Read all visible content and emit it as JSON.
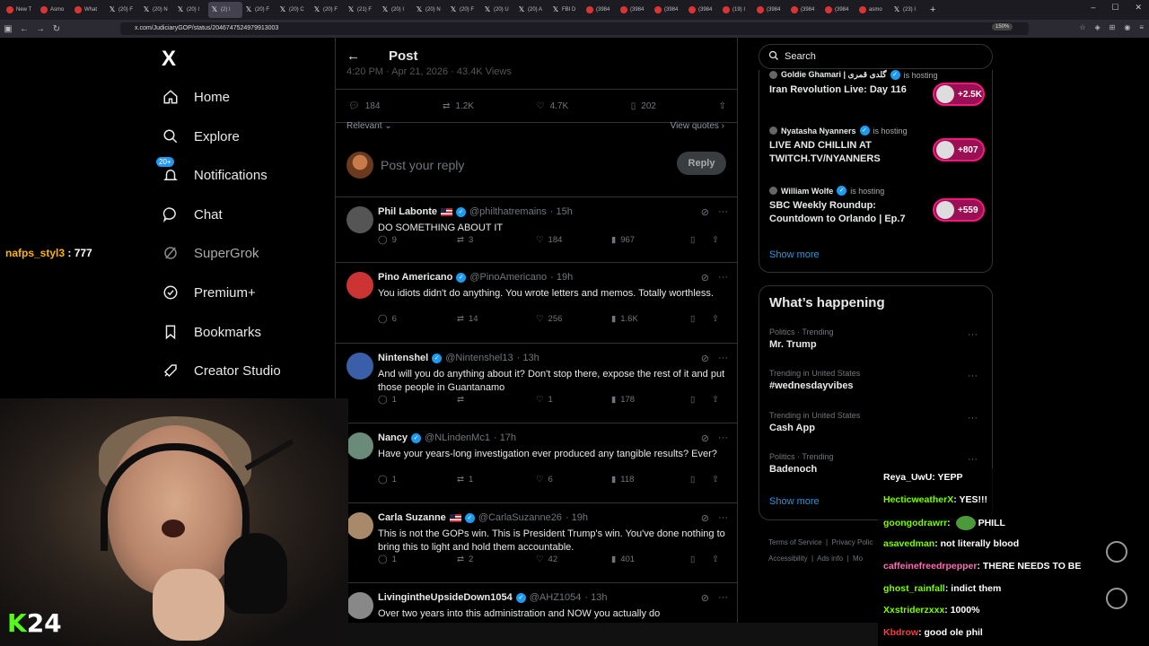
{
  "browser": {
    "tabs": [
      {
        "label": "New T",
        "fav": "red"
      },
      {
        "label": "Asmo",
        "fav": "red"
      },
      {
        "label": "What",
        "fav": "red"
      },
      {
        "label": "(20) F",
        "fav": "x"
      },
      {
        "label": "(20) N",
        "fav": "x"
      },
      {
        "label": "(20) I",
        "fav": "x"
      },
      {
        "label": "(20) F",
        "fav": "x"
      },
      {
        "label": "(20) C",
        "fav": "x"
      },
      {
        "label": "(20) F",
        "fav": "x"
      },
      {
        "label": "(21) F",
        "fav": "x"
      },
      {
        "label": "(20) I",
        "fav": "x"
      },
      {
        "label": "(20) N",
        "fav": "x"
      },
      {
        "label": "(20) F",
        "fav": "x"
      },
      {
        "label": "(20) U",
        "fav": "x"
      },
      {
        "label": "(20) A",
        "fav": "x"
      },
      {
        "label": "FBI D",
        "fav": "x"
      },
      {
        "label": "(3984",
        "fav": "red"
      },
      {
        "label": "(3984",
        "fav": "red"
      },
      {
        "label": "(3984",
        "fav": "red"
      },
      {
        "label": "(3984",
        "fav": "red"
      },
      {
        "label": "(19) I",
        "fav": "red"
      },
      {
        "label": "(3984",
        "fav": "red"
      },
      {
        "label": "(3984",
        "fav": "red"
      },
      {
        "label": "(3984",
        "fav": "red"
      },
      {
        "label": "asmo",
        "fav": "red"
      },
      {
        "label": "(23) I",
        "fav": "x"
      }
    ],
    "active_tab_label": "(2) I",
    "url": "x.com/JudiciaryGOP/status/2046747524979913003",
    "zoom": "150%"
  },
  "nav": {
    "logo": "X",
    "home": "Home",
    "explore": "Explore",
    "notifications": "Notifications",
    "notifications_badge": "20+",
    "chat": "Chat",
    "supergrok": "SuperGrok",
    "premium": "Premium+",
    "bookmarks": "Bookmarks",
    "creator_studio": "Creator Studio"
  },
  "post": {
    "header_title": "Post",
    "date_line": "4:20 PM · Apr 21, 2026 · 43.4K Views",
    "replies": "184",
    "reposts": "1.2K",
    "likes": "4.7K",
    "bookmarks": "202",
    "sort": "Relevant",
    "view_quotes": "View quotes",
    "reply_placeholder": "Post your reply",
    "reply_button": "Reply"
  },
  "replies": [
    {
      "name": "Phil Labonte",
      "flag": true,
      "handle": "@philthatremains",
      "time": "· 15h",
      "text": "DO SOMETHING ABOUT IT",
      "replies": "9",
      "reposts": "3",
      "likes": "184",
      "views": "967",
      "avatar": "#555"
    },
    {
      "name": "Pino Americano",
      "flag": false,
      "handle": "@PinoAmericano",
      "time": "· 19h",
      "text": "You idiots didn't do anything. You wrote letters and memos. Totally worthless.",
      "replies": "6",
      "reposts": "14",
      "likes": "256",
      "views": "1.6K",
      "avatar": "#c33"
    },
    {
      "name": "Nintenshel",
      "flag": false,
      "handle": "@Nintenshel13",
      "time": "· 13h",
      "text": "And will you do anything about it? Don't stop there, expose the rest of it and put those people in Guantanamo",
      "replies": "1",
      "reposts": "",
      "likes": "1",
      "views": "178",
      "avatar": "#3a5fa8"
    },
    {
      "name": "Nancy",
      "flag": false,
      "handle": "@NLindenMc1",
      "time": "· 17h",
      "text": "Have your years-long investigation ever produced any tangible results? Ever?",
      "replies": "1",
      "reposts": "1",
      "likes": "6",
      "views": "118",
      "avatar": "#6a8a7a"
    },
    {
      "name": "Carla Suzanne",
      "flag": true,
      "handle": "@CarlaSuzanne26",
      "time": "· 19h",
      "text": "This is not the GOPs win. This is President Trump's win. You've done nothing to bring this to light and hold them accountable.",
      "replies": "1",
      "reposts": "2",
      "likes": "42",
      "views": "401",
      "avatar": "#a88a6a"
    },
    {
      "name": "LivingintheUpsideDown1054",
      "flag": false,
      "handle": "@AHZ1054",
      "time": "· 13h",
      "text": "Over two years into this administration and NOW you actually do",
      "replies": "",
      "reposts": "",
      "likes": "",
      "views": "",
      "avatar": "#888"
    }
  ],
  "search": {
    "placeholder": "Search"
  },
  "live": [
    {
      "host": "Goldie Ghamari | گلدی قمری",
      "status": "is hosting",
      "title": "Iran Revolution Live: Day 116",
      "count": "+2.5K"
    },
    {
      "host": "Nyatasha Nyanners",
      "status": "is hosting",
      "title": "LIVE AND CHILLIN AT TWITCH.TV/NYANNERS",
      "count": "+807"
    },
    {
      "host": "William Wolfe",
      "status": "is hosting",
      "title": "SBC Weekly Roundup: Countdown to Orlando | Ep.7",
      "count": "+559"
    }
  ],
  "live_show_more": "Show more",
  "happening": {
    "title": "What’s happening",
    "trends": [
      {
        "category": "Politics · Trending",
        "name": "Mr. Trump"
      },
      {
        "category": "Trending in United States",
        "name": "#wednesdayvibes"
      },
      {
        "category": "Trending in United States",
        "name": "Cash App"
      },
      {
        "category": "Politics · Trending",
        "name": "Badenoch"
      }
    ],
    "show_more": "Show more"
  },
  "footer": {
    "terms": "Terms of Service",
    "privacy": "Privacy Polic",
    "accessibility": "Accessibility",
    "ads": "Ads info",
    "more": "Mo"
  },
  "overlay": {
    "nafps_user": "nafps_styl3",
    "nafps_value": ": 777",
    "kick_k": "K",
    "kick_num": "24"
  },
  "chat": [
    {
      "user": "Reya_UwU",
      "color": "#ffffff",
      "msg": "YEPP"
    },
    {
      "user": "HecticweatherX",
      "color": "#7cfc00",
      "msg": "YES!!!"
    },
    {
      "user": "goongodrawrr",
      "color": "#7cfc00",
      "msg": "PHILL",
      "emote": true
    },
    {
      "user": "asavedman",
      "color": "#7cfc00",
      "msg": "not literally blood"
    },
    {
      "user": "caffeinefreedrpepper",
      "color": "#ff6eb4",
      "msg": "THERE NEEDS TO BE"
    },
    {
      "user": "ghost_rainfall",
      "color": "#7cfc00",
      "msg": "indict them"
    },
    {
      "user": "Xxstriderzxxx",
      "color": "#7cfc00",
      "msg": "1000%"
    },
    {
      "user": "Kbdrow",
      "color": "#ff3b3b",
      "msg": "good ole phil"
    }
  ],
  "colors": {
    "accent": "#1d9bf0",
    "live_pill": "#f91880",
    "kick_green": "#53fc18"
  }
}
